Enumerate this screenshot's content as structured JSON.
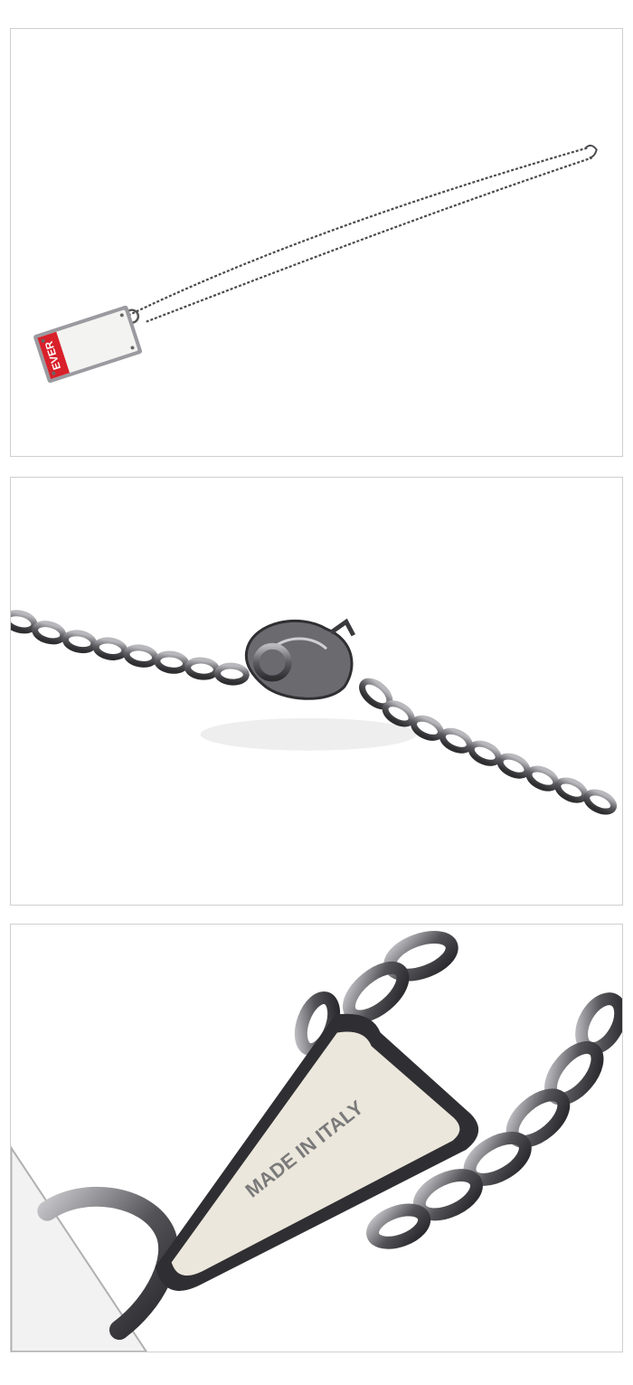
{
  "panels": [
    {
      "id": "p1",
      "subject": "necklace-full-view"
    },
    {
      "id": "p2",
      "subject": "clasp-closeup"
    },
    {
      "id": "p3",
      "subject": "bail-closeup"
    }
  ],
  "pendant": {
    "label": "EVER",
    "label_color": "#d8202a"
  },
  "bail": {
    "engraving": "MADE IN ITALY"
  },
  "colors": {
    "metal_dark": "#3a3a3e",
    "metal_mid": "#6e6e72",
    "metal_light": "#b9b9bd",
    "enamel": "#ece7dc"
  }
}
